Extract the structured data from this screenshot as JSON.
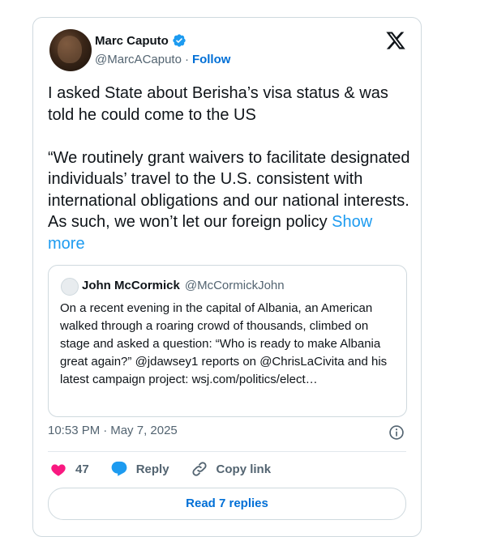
{
  "author": {
    "display_name": "Marc Caputo",
    "handle": "@MarcACaputo",
    "separator": "·",
    "follow_label": "Follow"
  },
  "tweet": {
    "text": "I asked State about Berisha’s visa status & was told he could come to the US\n\n“We routinely grant waivers to facilitate designated individuals’ travel to the U.S. consistent with international obligations and our national interests. As such, we won’t let our foreign policy ",
    "show_more_label": "Show more"
  },
  "quote": {
    "display_name": "John McCormick",
    "handle": "@McCormickJohn",
    "text": "On a recent evening in the capital of Albania, an American walked through a roaring crowd of thousands, climbed on stage and asked a question: “Who is ready to make Albania great again?” @jdawsey1 reports on @ChrisLaCivita and his latest campaign project: wsj.com/politics/elect…"
  },
  "meta": {
    "time": "10:53 PM",
    "separator": "·",
    "date": "May 7, 2025"
  },
  "actions": {
    "like_count": "47",
    "reply_label": "Reply",
    "copy_link_label": "Copy link"
  },
  "read_replies_label": "Read 7 replies",
  "colors": {
    "accent": "#1d9bf0",
    "link": "#006fd6",
    "like": "#f91880",
    "secondary_text": "#536471",
    "border": "#cfd9de"
  },
  "icons": {
    "verified": "verified-badge-icon",
    "logo": "x-logo-icon",
    "info": "info-icon",
    "like": "heart-icon",
    "reply": "speech-bubble-icon",
    "copy_link": "link-icon"
  }
}
